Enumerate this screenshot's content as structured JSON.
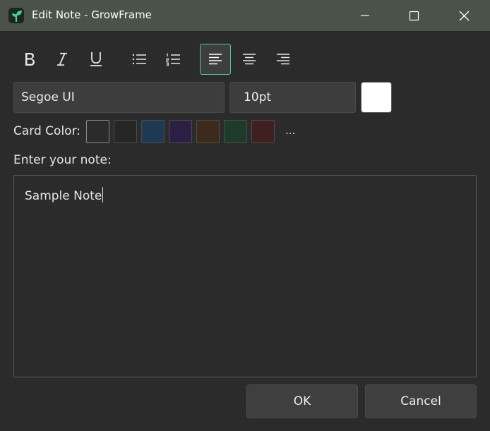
{
  "window": {
    "title": "Edit Note - GrowFrame"
  },
  "toolbar": {
    "buttons": [
      {
        "name": "bold-icon"
      },
      {
        "name": "italic-icon"
      },
      {
        "name": "underline-icon"
      },
      {
        "name": "bullet-list-icon"
      },
      {
        "name": "numbered-list-icon"
      },
      {
        "name": "align-left-icon",
        "active": true
      },
      {
        "name": "align-center-icon"
      },
      {
        "name": "align-right-icon"
      }
    ],
    "accent_color": "#4ec9a0"
  },
  "font": {
    "family": "Segoe UI",
    "size": "10pt",
    "text_color": "#ffffff"
  },
  "card_color": {
    "label": "Card Color:",
    "swatches": [
      "#2b2b2b",
      "#262626",
      "#1e3a52",
      "#2c1f45",
      "#3d2a1c",
      "#1e3a2a",
      "#3f1f1f"
    ],
    "more": "..."
  },
  "note": {
    "label": "Enter your note:",
    "value": "Sample Note"
  },
  "actions": {
    "ok": "OK",
    "cancel": "Cancel"
  }
}
